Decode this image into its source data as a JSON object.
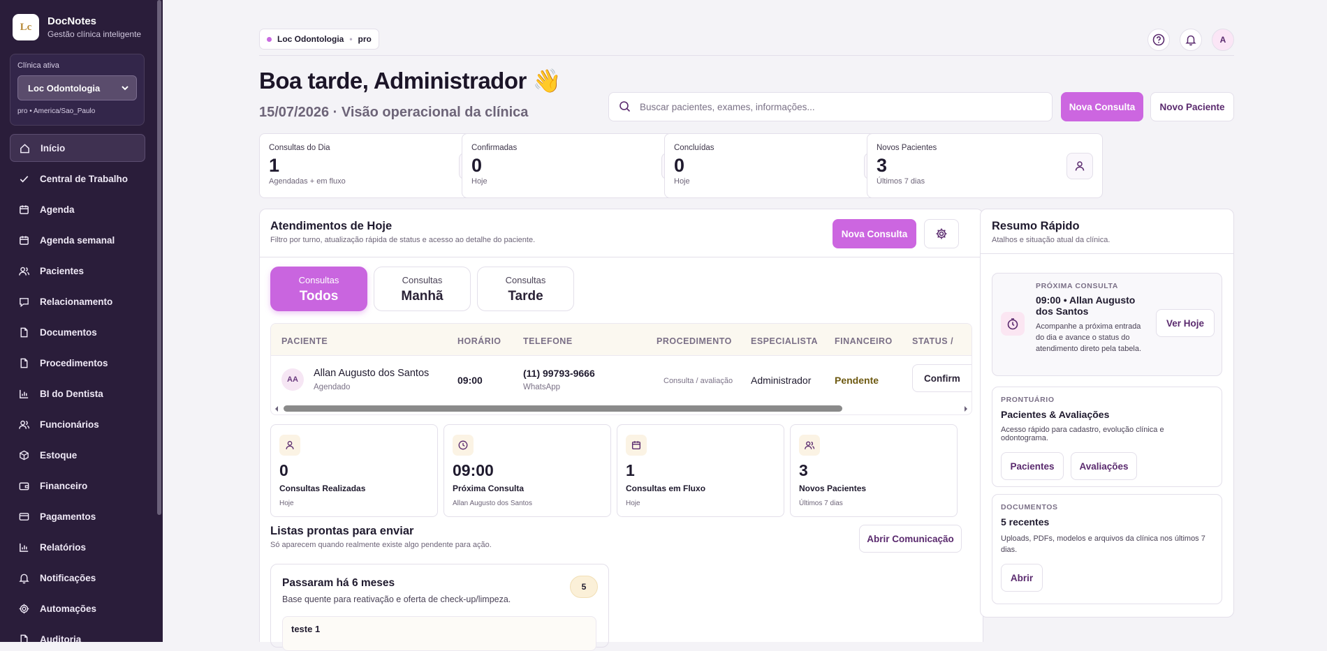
{
  "sidebar": {
    "brand": {
      "name": "DocNotes",
      "tagline": "Gestão clínica inteligente",
      "logo_text": "Lc"
    },
    "clinic": {
      "label": "Clínica ativa",
      "selected": "Loc Odontologia",
      "meta": "pro • America/Sao_Paulo"
    },
    "items": [
      {
        "label": "Início",
        "icon": "home-icon"
      },
      {
        "label": "Central de Trabalho",
        "icon": "check-icon"
      },
      {
        "label": "Agenda",
        "icon": "calendar-icon"
      },
      {
        "label": "Agenda semanal",
        "icon": "calendar-icon"
      },
      {
        "label": "Pacientes",
        "icon": "users-icon"
      },
      {
        "label": "Relacionamento",
        "icon": "chat-icon"
      },
      {
        "label": "Documentos",
        "icon": "document-icon"
      },
      {
        "label": "Procedimentos",
        "icon": "document-icon"
      },
      {
        "label": "BI do Dentista",
        "icon": "bar-chart-icon"
      },
      {
        "label": "Funcionários",
        "icon": "users-icon"
      },
      {
        "label": "Estoque",
        "icon": "box-icon"
      },
      {
        "label": "Financeiro",
        "icon": "wallet-icon"
      },
      {
        "label": "Pagamentos",
        "icon": "credit-card-icon"
      },
      {
        "label": "Relatórios",
        "icon": "bar-chart-icon"
      },
      {
        "label": "Notificações",
        "icon": "bell-icon"
      },
      {
        "label": "Automações",
        "icon": "gear-icon"
      },
      {
        "label": "Auditoria",
        "icon": "document-icon"
      }
    ]
  },
  "topbar": {
    "clinic": "Loc Odontologia",
    "plan": "pro",
    "avatar": "A"
  },
  "header": {
    "greeting": "Boa tarde, Administrador 👋",
    "subtitle": "15/07/2026 · Visão operacional da clínica",
    "search_placeholder": "Buscar pacientes, exames, informações...",
    "btn_new_consult": "Nova Consulta",
    "btn_new_patient": "Novo Paciente"
  },
  "stats": [
    {
      "title": "Consultas do Dia",
      "value": "1",
      "sub": "Agendadas + em fluxo",
      "icon": "calendar-icon"
    },
    {
      "title": "Confirmadas",
      "value": "0",
      "sub": "Hoje",
      "icon": "check-icon"
    },
    {
      "title": "Concluídas",
      "value": "0",
      "sub": "Hoje",
      "icon": "document-icon"
    },
    {
      "title": "Novos Pacientes",
      "value": "3",
      "sub": "Últimos 7 dias",
      "icon": "user-icon"
    }
  ],
  "today": {
    "title": "Atendimentos de Hoje",
    "subtitle": "Filtro por turno, atualização rápida de status e acesso ao detalhe do paciente.",
    "btn": "Nova Consulta",
    "tabs": [
      {
        "top": "Consultas",
        "label": "Todos"
      },
      {
        "top": "Consultas",
        "label": "Manhã"
      },
      {
        "top": "Consultas",
        "label": "Tarde"
      }
    ],
    "columns": [
      "PACIENTE",
      "HORÁRIO",
      "TELEFONE",
      "PROCEDIMENTO",
      "ESPECIALISTA",
      "FINANCEIRO",
      "STATUS /"
    ],
    "rows": [
      {
        "initials": "AA",
        "name": "Allan Augusto dos Santos",
        "status_sub": "Agendado",
        "time": "09:00",
        "phone": "(11) 99793-9666",
        "phone_sub": "WhatsApp",
        "procedure": "Consulta / avaliação",
        "specialist": "Administrador",
        "financial": "Pendente",
        "action": "Confirm"
      }
    ]
  },
  "kpis": [
    {
      "value": "0",
      "label": "Consultas Realizadas",
      "sub": "Hoje",
      "icon": "user-icon"
    },
    {
      "value": "09:00",
      "label": "Próxima Consulta",
      "sub": "Allan Augusto dos Santos",
      "icon": "clock-icon"
    },
    {
      "value": "1",
      "label": "Consultas em Fluxo",
      "sub": "Hoje",
      "icon": "calendar-icon"
    },
    {
      "value": "3",
      "label": "Novos Pacientes",
      "sub": "Últimos 7 dias",
      "icon": "users-icon"
    }
  ],
  "lists": {
    "title": "Listas prontas para enviar",
    "subtitle": "Só aparecem quando realmente existe algo pendente para ação.",
    "btn": "Abrir Comunicação",
    "card": {
      "title": "Passaram há 6 meses",
      "desc": "Base quente para reativação e oferta de check-up/limpeza.",
      "count": "5",
      "item": "teste 1"
    }
  },
  "summary": {
    "title": "Resumo Rápido",
    "subtitle": "Atalhos e situação atual da clínica.",
    "next": {
      "caption": "PRÓXIMA CONSULTA",
      "title": "09:00 • Allan Augusto dos Santos",
      "desc": "Acompanhe a próxima entrada do dia e avance o status do atendimento direto pela tabela.",
      "btn": "Ver Hoje"
    },
    "records": {
      "caption": "PRONTUÁRIO",
      "title": "Pacientes & Avaliações",
      "desc": "Acesso rápido para cadastro, evolução clínica e odontograma.",
      "btn1": "Pacientes",
      "btn2": "Avaliações"
    },
    "docs": {
      "caption": "DOCUMENTOS",
      "title": "5 recentes",
      "desc": "Uploads, PDFs, modelos e arquivos da clínica nos últimos 7 dias.",
      "btn": "Abrir"
    }
  }
}
